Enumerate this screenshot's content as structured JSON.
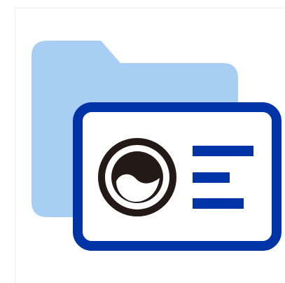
{
  "icon": {
    "name": "folder-contact-card-icon",
    "colors": {
      "folder": "#a9cef4",
      "card_border": "#0033a6",
      "card_fill": "#ffffff",
      "lines": "#0033a6",
      "avatar": "#231916"
    }
  }
}
